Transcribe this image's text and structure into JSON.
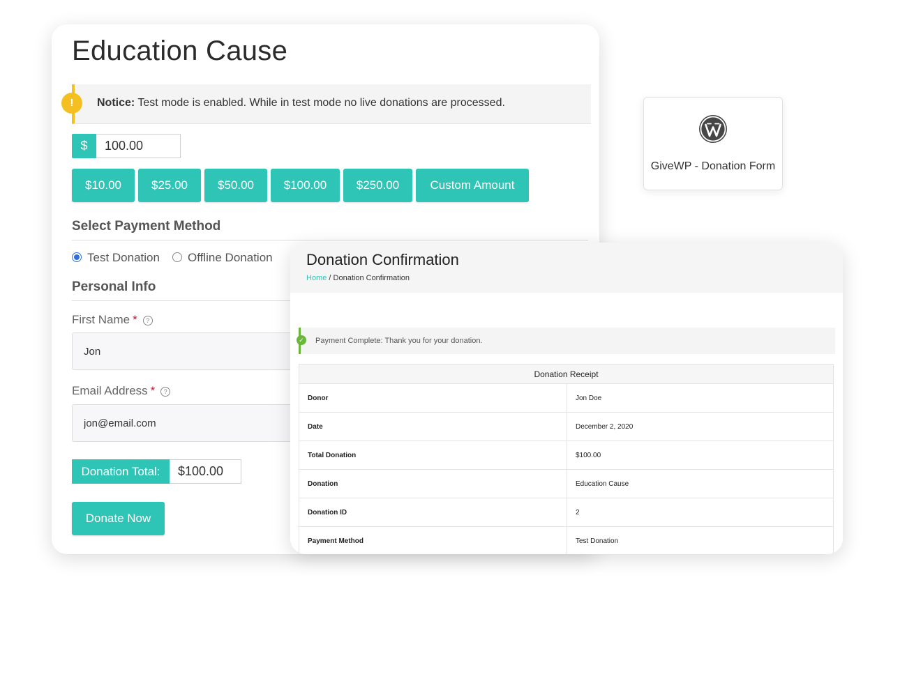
{
  "form": {
    "title": "Education Cause",
    "notice_label": "Notice:",
    "notice_text": "Test mode is enabled. While in test mode no live donations are processed.",
    "currency_symbol": "$",
    "amount": "100.00",
    "levels": [
      "$10.00",
      "$25.00",
      "$50.00",
      "$100.00",
      "$250.00",
      "Custom Amount"
    ],
    "payment_heading": "Select Payment Method",
    "payment_methods": [
      {
        "label": "Test Donation",
        "selected": true
      },
      {
        "label": "Offline Donation",
        "selected": false
      }
    ],
    "personal_heading": "Personal Info",
    "first_name_label": "First Name",
    "first_name_value": "Jon",
    "email_label": "Email Address",
    "email_value": "jon@email.com",
    "required_mark": "*",
    "help_glyph": "?",
    "total_label": "Donation Total:",
    "total_value": "$100.00",
    "donate_button": "Donate Now"
  },
  "wp_card": {
    "label": "GiveWP - Donation Form",
    "icon": "wordpress-icon"
  },
  "confirmation": {
    "title": "Donation Confirmation",
    "breadcrumb_home": "Home",
    "breadcrumb_sep": "/",
    "breadcrumb_current": "Donation Confirmation",
    "success_text": "Payment Complete: Thank you for your donation.",
    "receipt_heading": "Donation Receipt",
    "receipt_rows": [
      {
        "key": "Donor",
        "value": "Jon Doe"
      },
      {
        "key": "Date",
        "value": "December 2, 2020"
      },
      {
        "key": "Total Donation",
        "value": "$100.00"
      },
      {
        "key": "Donation",
        "value": "Education Cause"
      },
      {
        "key": "Donation ID",
        "value": "2"
      },
      {
        "key": "Payment Method",
        "value": "Test Donation"
      }
    ]
  },
  "colors": {
    "accent": "#2ec4b6",
    "notice": "#f4c021",
    "success": "#69b63a",
    "required": "#c8102e",
    "radio_selected": "#2f6fde"
  }
}
